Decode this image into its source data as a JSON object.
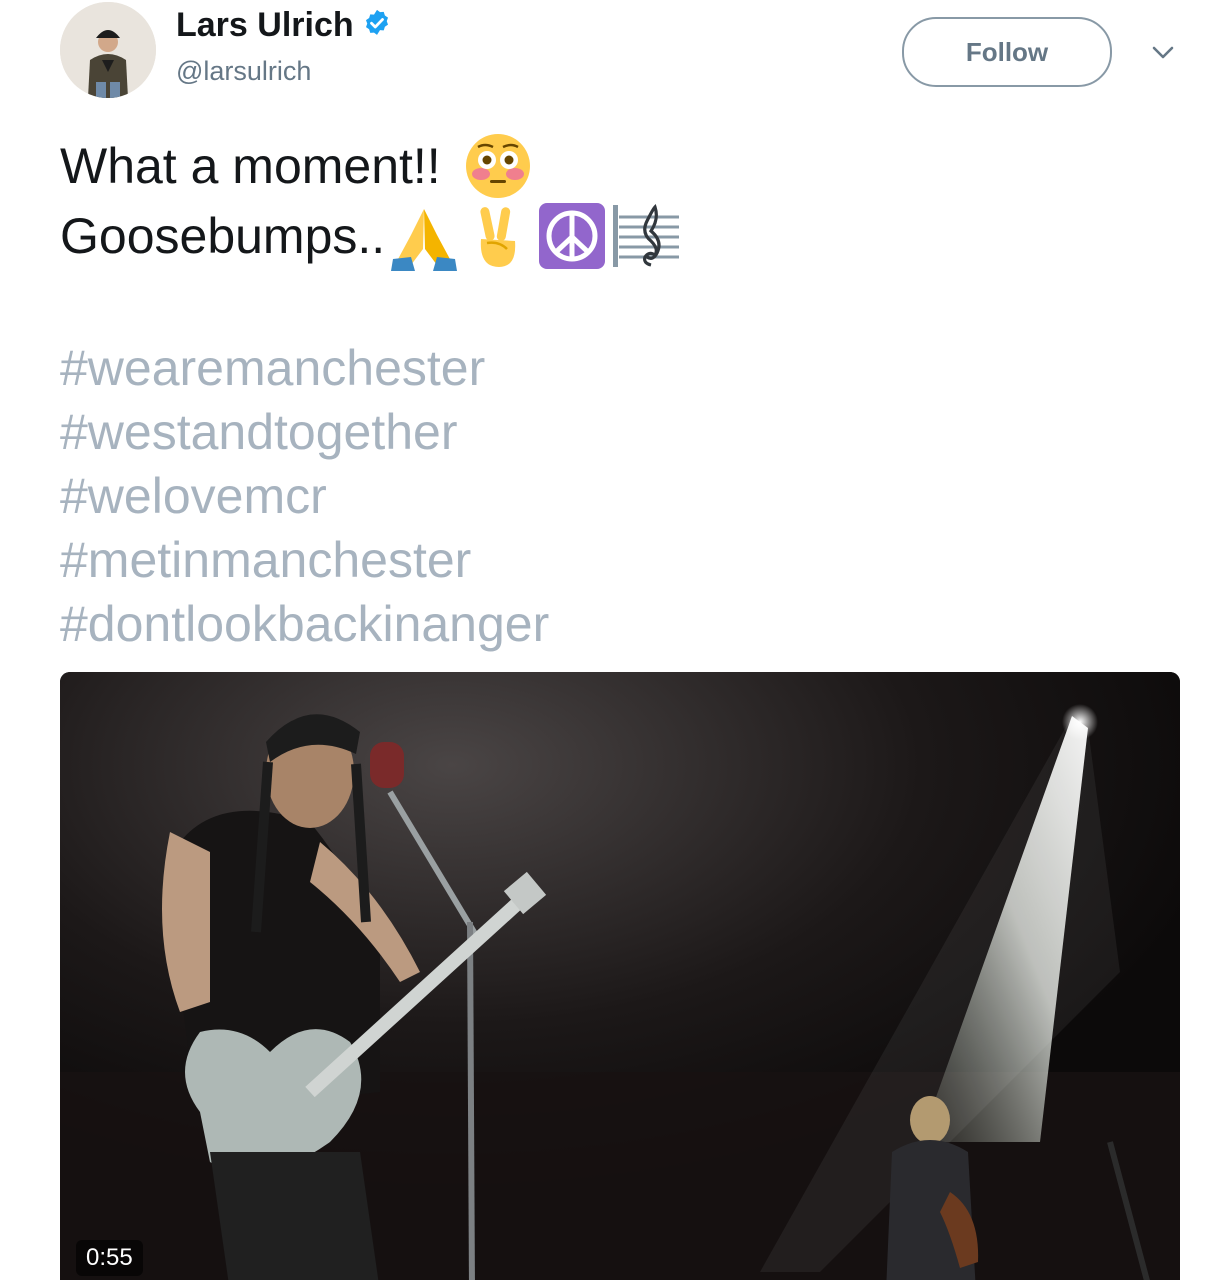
{
  "user": {
    "display_name": "Lars Ulrich",
    "handle": "@larsulrich",
    "verified": true
  },
  "actions": {
    "follow_label": "Follow"
  },
  "tweet": {
    "line1": "What a moment!!",
    "line2": "Goosebumps..",
    "emojis": [
      "flushed-face",
      "folded-hands",
      "victory-hand",
      "peace-symbol",
      "musical-score"
    ],
    "hashtags": [
      "#wearemanchester",
      "#westandtogether",
      "#welovemcr",
      "#metinmanchester",
      "#dontlookbackinanger"
    ]
  },
  "media": {
    "type": "video",
    "duration": "0:55"
  },
  "colors": {
    "text": "#14171a",
    "secondary": "#657786",
    "hashtag": "#a7b3bf",
    "verified": "#1da1f2",
    "button_border": "#8899a6"
  }
}
